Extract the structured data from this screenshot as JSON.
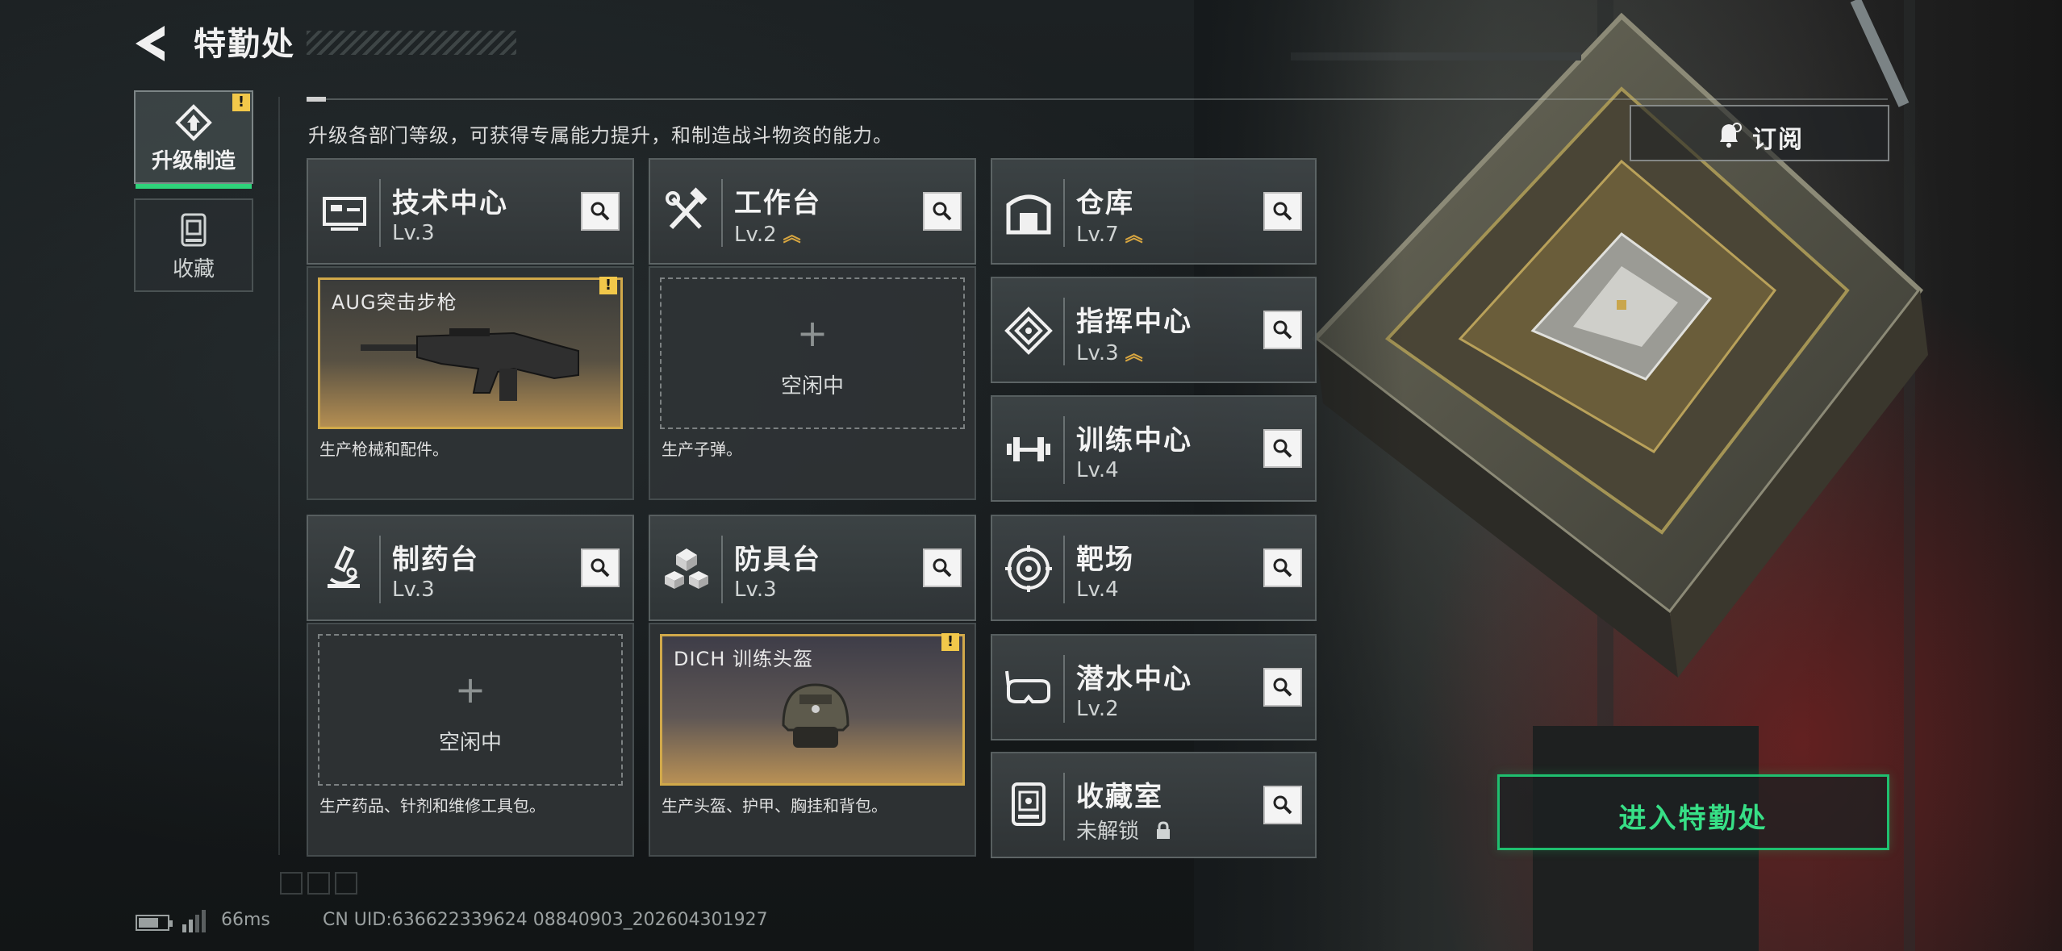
{
  "header": {
    "title": "特勤处"
  },
  "tabs": [
    {
      "label": "升级制造",
      "active": true,
      "badge": "!"
    },
    {
      "label": "收藏",
      "active": false
    }
  ],
  "intro": "升级各部门等级，可获得专属能力提升，和制造战斗物资的能力。",
  "departments": {
    "tech": {
      "name": "技术中心",
      "level": "Lv.3",
      "upgradable": false
    },
    "bench": {
      "name": "工作台",
      "level": "Lv.2",
      "upgradable": true
    },
    "pharma": {
      "name": "制药台",
      "level": "Lv.3",
      "upgradable": false
    },
    "armor": {
      "name": "防具台",
      "level": "Lv.3",
      "upgradable": false
    },
    "storage": {
      "name": "仓库",
      "level": "Lv.7",
      "upgradable": true
    },
    "command": {
      "name": "指挥中心",
      "level": "Lv.3",
      "upgradable": true
    },
    "training": {
      "name": "训练中心",
      "level": "Lv.4",
      "upgradable": false
    },
    "range": {
      "name": "靶场",
      "level": "Lv.4",
      "upgradable": false
    },
    "diving": {
      "name": "潜水中心",
      "level": "Lv.2",
      "upgradable": false
    },
    "vault": {
      "name": "收藏室",
      "level": "未解锁",
      "locked": true
    }
  },
  "production": {
    "tech": {
      "item": "AUG突击步枪",
      "desc": "生产枪械和配件。",
      "badge": "!"
    },
    "bench": {
      "idle": "空闲中",
      "plus": "+",
      "desc": "生产子弹。"
    },
    "pharma": {
      "idle": "空闲中",
      "plus": "+",
      "desc": "生产药品、针剂和维修工具包。"
    },
    "armor": {
      "item": "DICH 训练头盔",
      "desc": "生产头盔、护甲、胸挂和背包。",
      "badge": "!"
    }
  },
  "buttons": {
    "subscribe": "订阅",
    "enter": "进入特勤处"
  },
  "status": {
    "ping": "66ms",
    "uid": "CN UID:636622339624 08840903_202604301927"
  },
  "colors": {
    "accent_green": "#2ed27a",
    "upgrade_gold": "#d8a640",
    "warning_yellow": "#f2c84a"
  }
}
